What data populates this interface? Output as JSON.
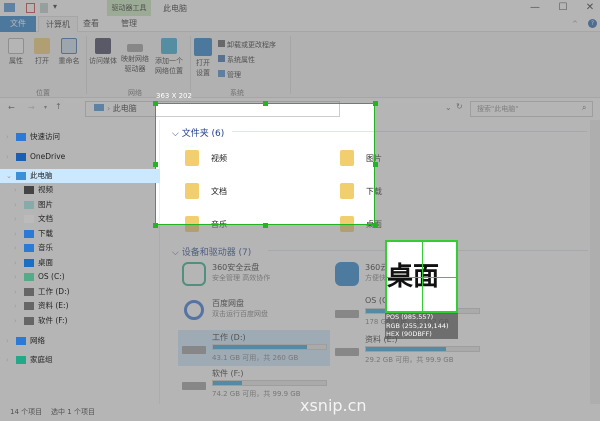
{
  "window": {
    "title": "此电脑",
    "context_tab": "驱动器工具",
    "minimize": "—",
    "maximize": "☐",
    "close": "✕"
  },
  "tabs": [
    {
      "label": "文件"
    },
    {
      "label": "计算机"
    },
    {
      "label": "查看"
    },
    {
      "label": "管理"
    }
  ],
  "ribbon": {
    "groups": [
      {
        "label": "位置",
        "buttons": [
          "属性",
          "打开",
          "重命名"
        ]
      },
      {
        "label": "网络",
        "buttons": [
          "访问媒体",
          "映射网络\n驱动器",
          "添加一个\n网络位置"
        ]
      },
      {
        "label": "系统",
        "buttons": [
          "打开\n设置"
        ],
        "small": [
          "卸载或更改程序",
          "系统属性",
          "管理"
        ]
      }
    ]
  },
  "address": {
    "path": "此电脑",
    "search_placeholder": "搜索\"此电脑\""
  },
  "nav": [
    {
      "label": "快速访问",
      "icon": "star-icon",
      "color": "#2b7bd6"
    },
    {
      "label": "OneDrive",
      "icon": "cloud-icon",
      "color": "#1a5fb4"
    },
    {
      "label": "此电脑",
      "icon": "computer-icon",
      "color": "#3d8fd8"
    },
    {
      "label": "视频",
      "icon": "video-icon",
      "color": "#444"
    },
    {
      "label": "图片",
      "icon": "picture-icon",
      "color": "#8aa"
    },
    {
      "label": "文档",
      "icon": "document-icon",
      "color": "#bbb"
    },
    {
      "label": "下载",
      "icon": "download-icon",
      "color": "#2b7bd6"
    },
    {
      "label": "音乐",
      "icon": "music-icon",
      "color": "#2b7bd6"
    },
    {
      "label": "桌面",
      "icon": "desktop-icon",
      "color": "#1a6fc4"
    },
    {
      "label": "OS (C:)",
      "icon": "drive-icon",
      "color": "#5a8"
    },
    {
      "label": "工作 (D:)",
      "icon": "drive-icon",
      "color": "#666"
    },
    {
      "label": "资料 (E:)",
      "icon": "drive-icon",
      "color": "#666"
    },
    {
      "label": "软件 (F:)",
      "icon": "drive-icon",
      "color": "#666"
    },
    {
      "label": "网络",
      "icon": "network-icon",
      "color": "#2b7bd6"
    },
    {
      "label": "家庭组",
      "icon": "homegroup-icon",
      "color": "#2a8"
    }
  ],
  "folders": {
    "header": "文件夹 (6)",
    "items": [
      "视频",
      "图片",
      "文档",
      "下载",
      "音乐",
      "桌面"
    ]
  },
  "devices": {
    "header": "设备和驱动器 (7)",
    "items": [
      {
        "name": "360安全云盘",
        "sub": "安全管理 高效协作"
      },
      {
        "name": "360云",
        "sub": "方便快"
      },
      {
        "name": "百度网盘",
        "sub": "双击运行百度网盘"
      },
      {
        "name": "OS (C:)",
        "sub": "178 GB 可用，共 232 GB",
        "used": 0.25
      },
      {
        "name": "工作 (D:)",
        "sub": "43.1 GB 可用，共 260 GB",
        "used": 0.83
      },
      {
        "name": "资料 (E:)",
        "sub": "29.2 GB 可用，共 99.9 GB",
        "used": 0.71
      },
      {
        "name": "软件 (F:)",
        "sub": "74.2 GB 可用，共 99.9 GB",
        "used": 0.26
      }
    ]
  },
  "status": {
    "count": "14 个项目",
    "selected": "选中 1 个项目"
  },
  "snip": {
    "size": "363 X 202",
    "magnified": "桌面",
    "pos": "POS (985,557)",
    "rgb": "RGB (255,219,144)",
    "hex": "HEX (90DBFF)",
    "watermark": "xsnip.cn"
  },
  "colors": {
    "accent": "#1979ca",
    "selection": "#22b422",
    "progress": "#26a0da"
  }
}
